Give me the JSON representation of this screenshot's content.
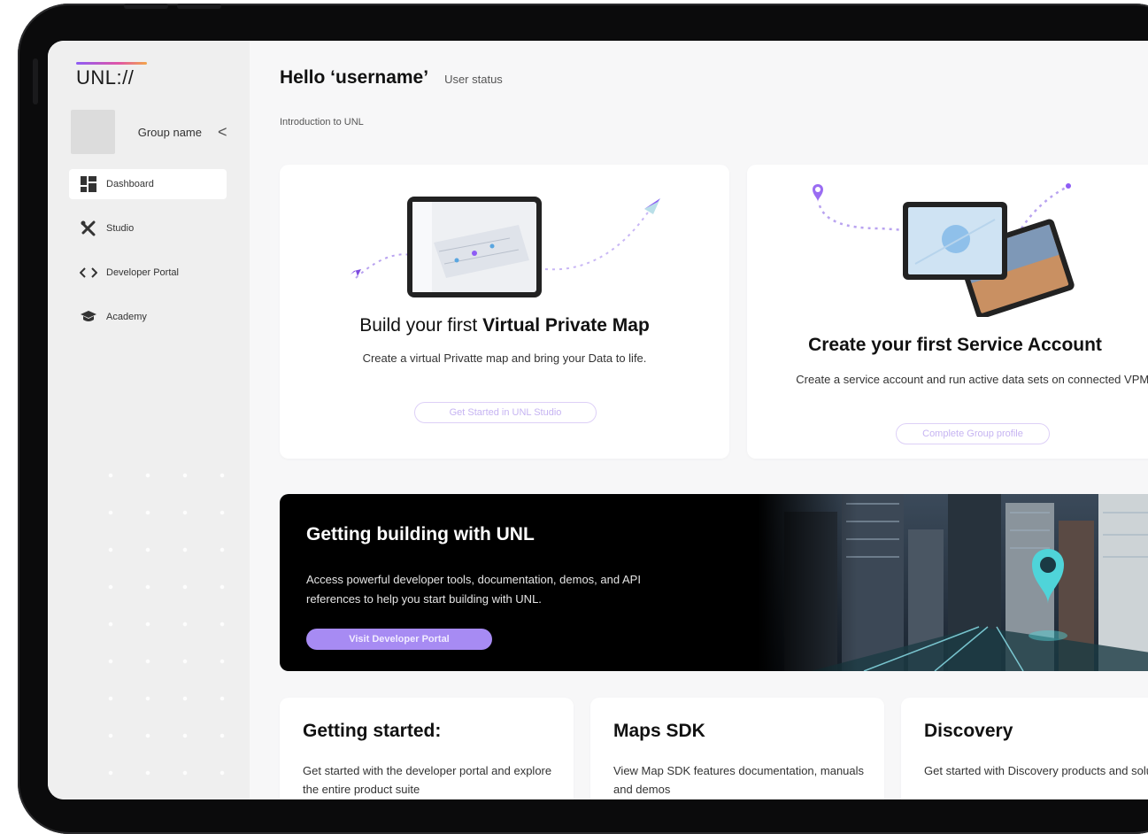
{
  "logo": {
    "text": "UNL://"
  },
  "sidebar": {
    "group_name": "Group name",
    "collapse_glyph": "<",
    "items": [
      {
        "label": "Dashboard",
        "icon": "dashboard-icon",
        "active": true
      },
      {
        "label": "Studio",
        "icon": "studio-tools-icon",
        "active": false
      },
      {
        "label": "Developer Portal",
        "icon": "code-brackets-icon",
        "active": false
      },
      {
        "label": "Academy",
        "icon": "graduation-cap-icon",
        "active": false
      }
    ]
  },
  "header": {
    "title": "Hello ‘username’",
    "status": "User status",
    "intro": "Introduction to UNL"
  },
  "cards": {
    "vpm": {
      "title_prefix": "Build your first ",
      "title_bold": "Virtual Private Map",
      "description": "Create a virtual Privatte map and bring your Data to life.",
      "button": "Get Started in UNL Studio"
    },
    "service_account": {
      "title": "Create your first Service Account",
      "description": "Create a service account and run active data sets on connected VPMs",
      "button": "Complete Group profile"
    }
  },
  "banner": {
    "title": "Getting building with UNL",
    "description": "Access powerful developer tools, documentation, demos, and API references to help you start building with UNL.",
    "button": "Visit Developer Portal"
  },
  "small_cards": [
    {
      "title": "Getting started:",
      "description": "Get started with the developer portal and explore the entire product suite"
    },
    {
      "title": "Maps SDK",
      "description": "View Map SDK features documentation, manuals and demos"
    },
    {
      "title": "Discovery",
      "description": "Get started with Discovery products and solutions"
    }
  ],
  "colors": {
    "accent_purple": "#a78bf3",
    "outline_button": "#ddd0f7",
    "banner_bg": "#000000",
    "screen_bg": "#f7f7f8",
    "sidebar_bg": "#efefef"
  }
}
